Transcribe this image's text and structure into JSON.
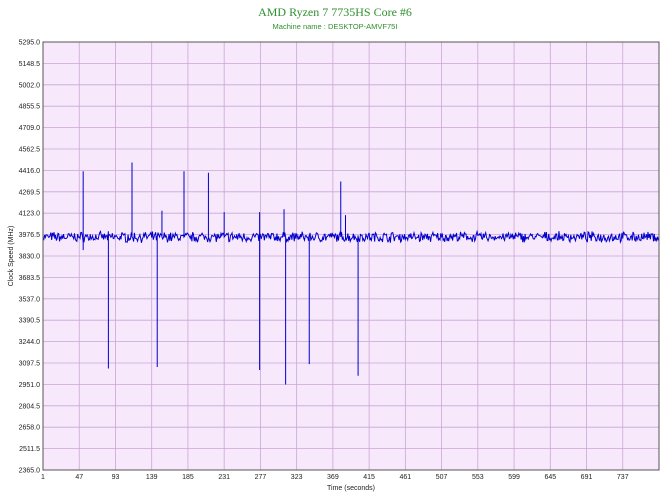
{
  "chart_data": {
    "type": "line",
    "title": "AMD Ryzen 7 7735HS Core #6",
    "subtitle": "Machine name : DESKTOP-AMVF75I",
    "xlabel": "Time (seconds)",
    "ylabel": "Clock Speed (MHz)",
    "xlim": [
      1,
      783
    ],
    "ylim": [
      2365.0,
      5295.0
    ],
    "x_ticks": [
      1,
      47,
      93,
      139,
      185,
      231,
      277,
      323,
      369,
      415,
      461,
      507,
      553,
      599,
      645,
      691,
      737
    ],
    "y_ticks": [
      "5295.0",
      "5148.5",
      "5002.0",
      "4855.5",
      "4709.0",
      "4562.5",
      "4416.0",
      "4269.5",
      "4123.0",
      "3976.5",
      "3830.0",
      "3683.5",
      "3537.0",
      "3390.5",
      "3244.0",
      "3097.5",
      "2951.0",
      "2804.5",
      "2658.0",
      "2511.5",
      "2365.0"
    ],
    "grid": true,
    "background_color": "#f7e9fb",
    "grid_color": "#c9a6d6",
    "series": [
      {
        "color": "#0000cc",
        "baseline": 3960,
        "spikes": [
          {
            "x": 52,
            "value": 4410
          },
          {
            "x": 52,
            "value": 3870
          },
          {
            "x": 84,
            "value": 3060
          },
          {
            "x": 114,
            "value": 4470
          },
          {
            "x": 146,
            "value": 3070
          },
          {
            "x": 152,
            "value": 4140
          },
          {
            "x": 180,
            "value": 4410
          },
          {
            "x": 211,
            "value": 4400
          },
          {
            "x": 231,
            "value": 4130
          },
          {
            "x": 276,
            "value": 4130
          },
          {
            "x": 276,
            "value": 3050
          },
          {
            "x": 307,
            "value": 4150
          },
          {
            "x": 309,
            "value": 2950
          },
          {
            "x": 309,
            "value": 3350
          },
          {
            "x": 339,
            "value": 3090
          },
          {
            "x": 379,
            "value": 4340
          },
          {
            "x": 385,
            "value": 4110
          },
          {
            "x": 401,
            "value": 3010
          }
        ]
      }
    ]
  }
}
